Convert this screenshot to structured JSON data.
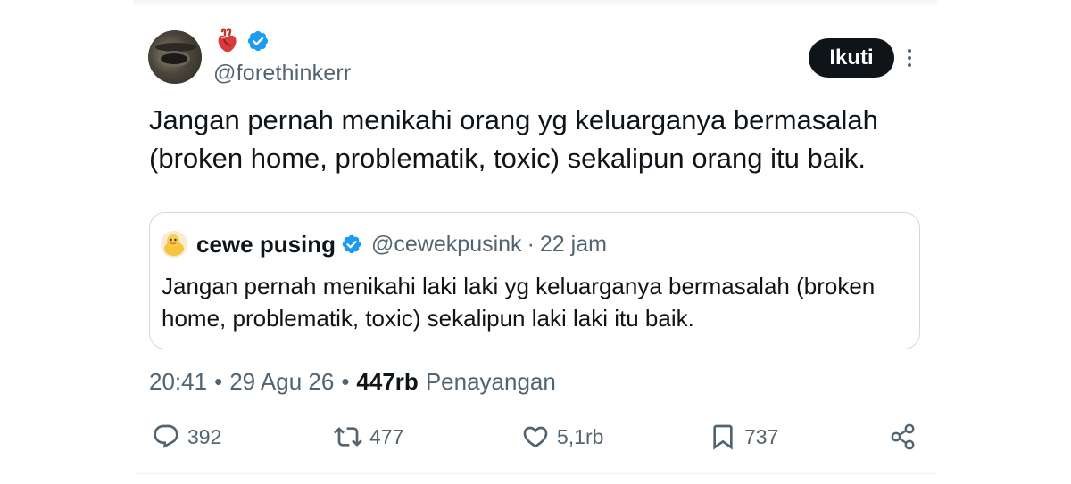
{
  "author": {
    "display_name_icons": [
      "anatomical-heart-icon",
      "verified-badge-icon"
    ],
    "handle": "@forethinkerr"
  },
  "follow_button": {
    "label": "Ikuti"
  },
  "tweet": {
    "text": "Jangan pernah menikahi orang yg keluarganya bermasalah (broken home, problematik, toxic) sekalipun orang itu baik."
  },
  "quoted_tweet": {
    "name": "cewe pusing",
    "handle": "@cewekpusink",
    "separator": "·",
    "time": "22 jam",
    "text": "Jangan pernah menikahi laki laki yg keluarganya bermasalah (broken home, problematik, toxic) sekalipun laki laki itu baik."
  },
  "meta": {
    "time": "20:41",
    "separator": "•",
    "date": "29 Agu 26",
    "views_count": "447rb",
    "views_label": "Penayangan"
  },
  "actions": {
    "reply_count": "392",
    "repost_count": "477",
    "like_count": "5,1rb",
    "bookmark_count": "737"
  },
  "colors": {
    "text_primary": "#0f1419",
    "text_secondary": "#536471",
    "verified_blue": "#1d9bf0",
    "border": "#cfd9de"
  }
}
